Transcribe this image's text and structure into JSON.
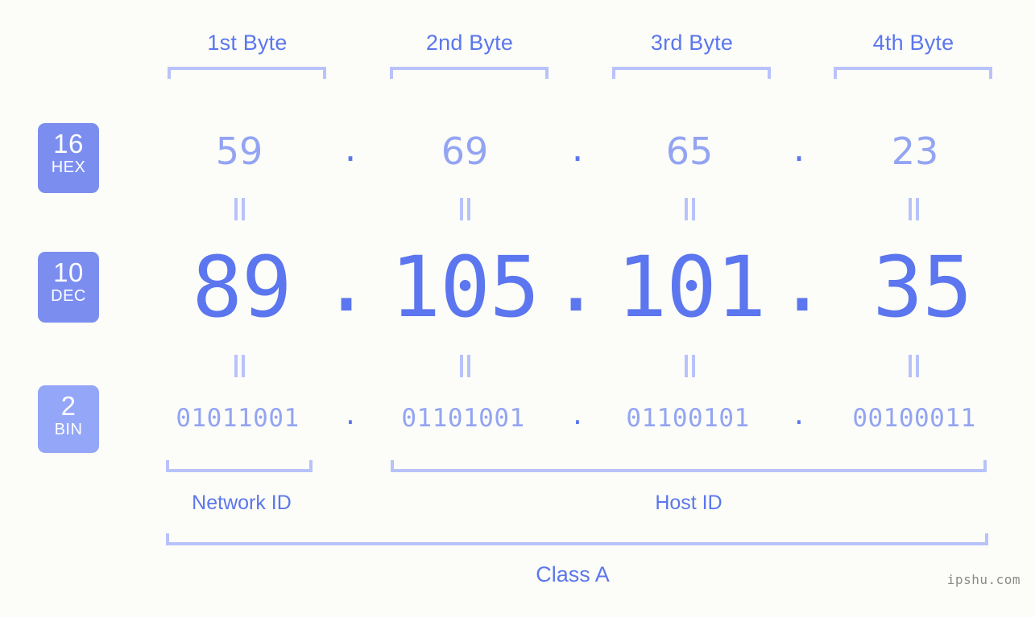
{
  "meta": {
    "background_color": "#fcfdf8",
    "accent_color": "#5b76ee",
    "accent_light_color": "#93a4f3",
    "bracket_color": "#b8c2fb",
    "badge_color": "#7b8ef0",
    "badge_light_color": "#93a6f7",
    "watermark": "ipshu.com"
  },
  "byte_headers": [
    {
      "label": "1st Byte"
    },
    {
      "label": "2nd Byte"
    },
    {
      "label": "3rd Byte"
    },
    {
      "label": "4th Byte"
    }
  ],
  "bases": [
    {
      "number": "16",
      "abbr": "HEX"
    },
    {
      "number": "10",
      "abbr": "DEC"
    },
    {
      "number": "2",
      "abbr": "BIN"
    }
  ],
  "rows": {
    "hex": {
      "base": "16",
      "name": "HEX",
      "values": [
        "59",
        "69",
        "65",
        "23"
      ],
      "separator": "."
    },
    "dec": {
      "base": "10",
      "name": "DEC",
      "values": [
        "89",
        "105",
        "101",
        "35"
      ],
      "separator": "."
    },
    "bin": {
      "base": "2",
      "name": "BIN",
      "values": [
        "01011001",
        "01101001",
        "01100101",
        "00100011"
      ],
      "separator": "."
    }
  },
  "connectors": {
    "symbol": "=",
    "count_per_row": 4
  },
  "ip_address": {
    "decimal": "89.105.101.35",
    "hex": "59.69.65.23",
    "binary": "01011001.01101001.01100101.00100011"
  },
  "segments": {
    "network_id": {
      "label": "Network ID",
      "bytes": [
        1
      ]
    },
    "host_id": {
      "label": "Host ID",
      "bytes": [
        2,
        3,
        4
      ]
    },
    "class": {
      "label": "Class A"
    }
  }
}
